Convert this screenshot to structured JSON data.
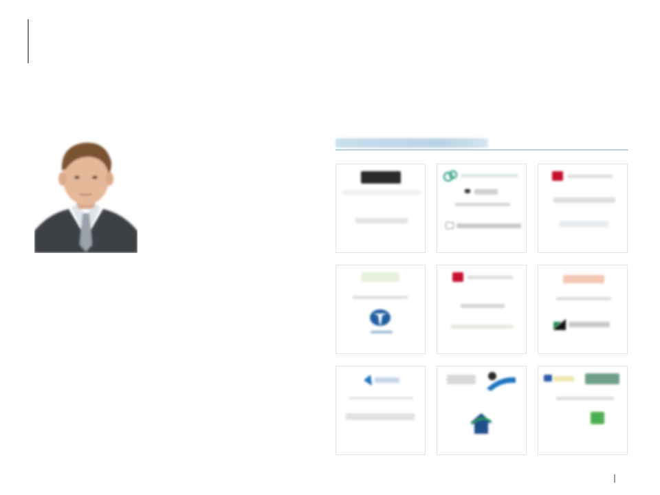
{
  "header": {
    "title": "",
    "subtitle": ""
  },
  "profile": {
    "name": "",
    "role": ""
  },
  "bio": {
    "paragraph_1": "",
    "paragraph_1_tail": "",
    "paragraph_2": "",
    "paragraph_2_tail": "",
    "paragraph_3": ""
  },
  "section": {
    "title": ""
  },
  "cards": [
    {
      "caption": ""
    },
    {
      "caption": ""
    },
    {
      "caption": ""
    },
    {
      "caption": ""
    },
    {
      "caption": ""
    },
    {
      "caption": ""
    },
    {
      "caption": ""
    },
    {
      "caption": ""
    },
    {
      "caption": ""
    }
  ],
  "footer": {
    "note": ""
  },
  "colors": {
    "accent": "#7f7f7f",
    "section_rule": "#b8cfdc",
    "card_border": "#e3e3e3",
    "logo_red": "#c8102e",
    "logo_blue": "#1f5f9f",
    "logo_green": "#4caf50"
  },
  "icons": [
    "portrait-photo",
    "company-logo-dark-block",
    "company-logo-green-circles",
    "company-logo-red-crest",
    "company-logo-tata",
    "company-logo-red-crest-2",
    "company-logo-orange-wordmark",
    "company-logo-diagonal-mark",
    "company-logo-blue-shield",
    "company-logo-blue-swoosh",
    "company-logo-house",
    "company-logo-green-block"
  ]
}
